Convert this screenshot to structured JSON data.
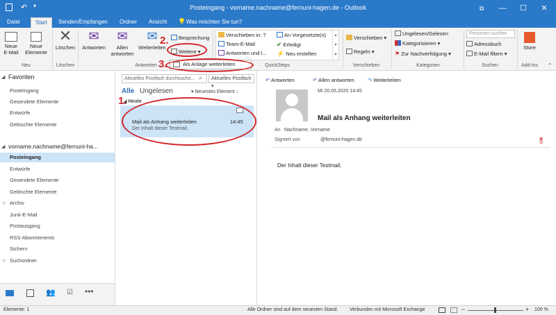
{
  "window": {
    "title": "Posteingang - vorname.nachname@fernuni-hagen.de - Outlook",
    "minimize": "—",
    "maximize": "☐",
    "close": "✕"
  },
  "tabs": [
    "Datei",
    "Start",
    "Senden/Empfangen",
    "Ordner",
    "Ansicht"
  ],
  "tell_me": "Was möchten Sie tun?",
  "ribbon": {
    "new_email_line1": "Neue",
    "new_email_line2": "E-Mail",
    "new_items_line1": "Neue",
    "new_items_line2": "Elemente",
    "group_new": "Neu",
    "delete": "Löschen",
    "group_delete": "Löschen",
    "reply": "Antworten",
    "reply_all_line1": "Allen",
    "reply_all_line2": "antworten",
    "forward": "Weiterleiten",
    "meeting": "Besprechung",
    "more": "Weitere",
    "group_respond": "Antworten",
    "qs_moved": "Verschieben in: ?",
    "qs_team": "Team-E-Mail",
    "qs_reply_delete": "Antworten und l...",
    "qs_manager": "An Vorgesetzte(n)",
    "qs_done": "Erledigt",
    "qs_create": "Neu erstellen",
    "group_quicksteps": "QuickSteps",
    "move": "Verschieben",
    "rules": "Regeln",
    "group_move": "Verschieben",
    "unread_read": "Ungelesen/Gelesen",
    "categorize": "Kategorisieren",
    "followup": "Zur Nachverfolgung",
    "group_tags": "Kategorien",
    "search_people_placeholder": "Personen suchen",
    "address_book": "Adressbuch",
    "filter_email": "E-Mail filtern",
    "group_find": "Suchen",
    "store": "Store",
    "group_addins": "Add-Ins"
  },
  "dropdown": {
    "forward_as_attachment": "Als Anlage weiterleiten"
  },
  "annotations": {
    "n1": "1.",
    "n2": "2.",
    "n3": "3."
  },
  "folders": {
    "favorites_header": "Favoriten",
    "favorites": [
      "Posteingang",
      "Gesendete Elemente",
      "Entwürfe",
      "Gelöschte Elemente"
    ],
    "account": "vorname.nachname@fernuni-ha...",
    "inbox": "Posteingang",
    "items": [
      "Entwürfe",
      "Gesendete Elemente",
      "Gelöschte Elemente",
      "Archiv",
      "Junk-E-Mail",
      "Postausgang",
      "RSS-Abonnements",
      "Sichern",
      "Suchordner"
    ]
  },
  "msglist": {
    "search_placeholder": "Aktuelles Postfach durchsuche...",
    "scope": "Aktuelles Postfach",
    "filter_all": "Alle",
    "filter_unread": "Ungelesen",
    "sort": "Neuestes Element",
    "group_today": "Heute",
    "message": {
      "subject": "Mail als Anhang weiterleiten",
      "time": "14:45",
      "preview": "Der Inhalt dieser Testmail."
    }
  },
  "reading": {
    "reply": "Antworten",
    "reply_all": "Allen antworten",
    "forward": "Weiterleiten",
    "date": "Mi 20.05.2020 14:45",
    "subject": "Mail als Anhang weiterleiten",
    "to_label": "An",
    "to_value": "Nachname, Vorname",
    "signed_label": "Signiert von",
    "signed_value": "@fernuni-hagen.de",
    "body": "Der Inhalt dieser Testmail."
  },
  "status": {
    "items": "Elemente: 1",
    "sync": "Alle Ordner sind auf dem neuesten Stand.",
    "connection": "Verbunden mit Microsoft Exchange",
    "zoom": "100 %"
  },
  "colors": {
    "accent": "#2b79c9",
    "annotation": "#d2262b",
    "selection": "#cde4f7"
  }
}
